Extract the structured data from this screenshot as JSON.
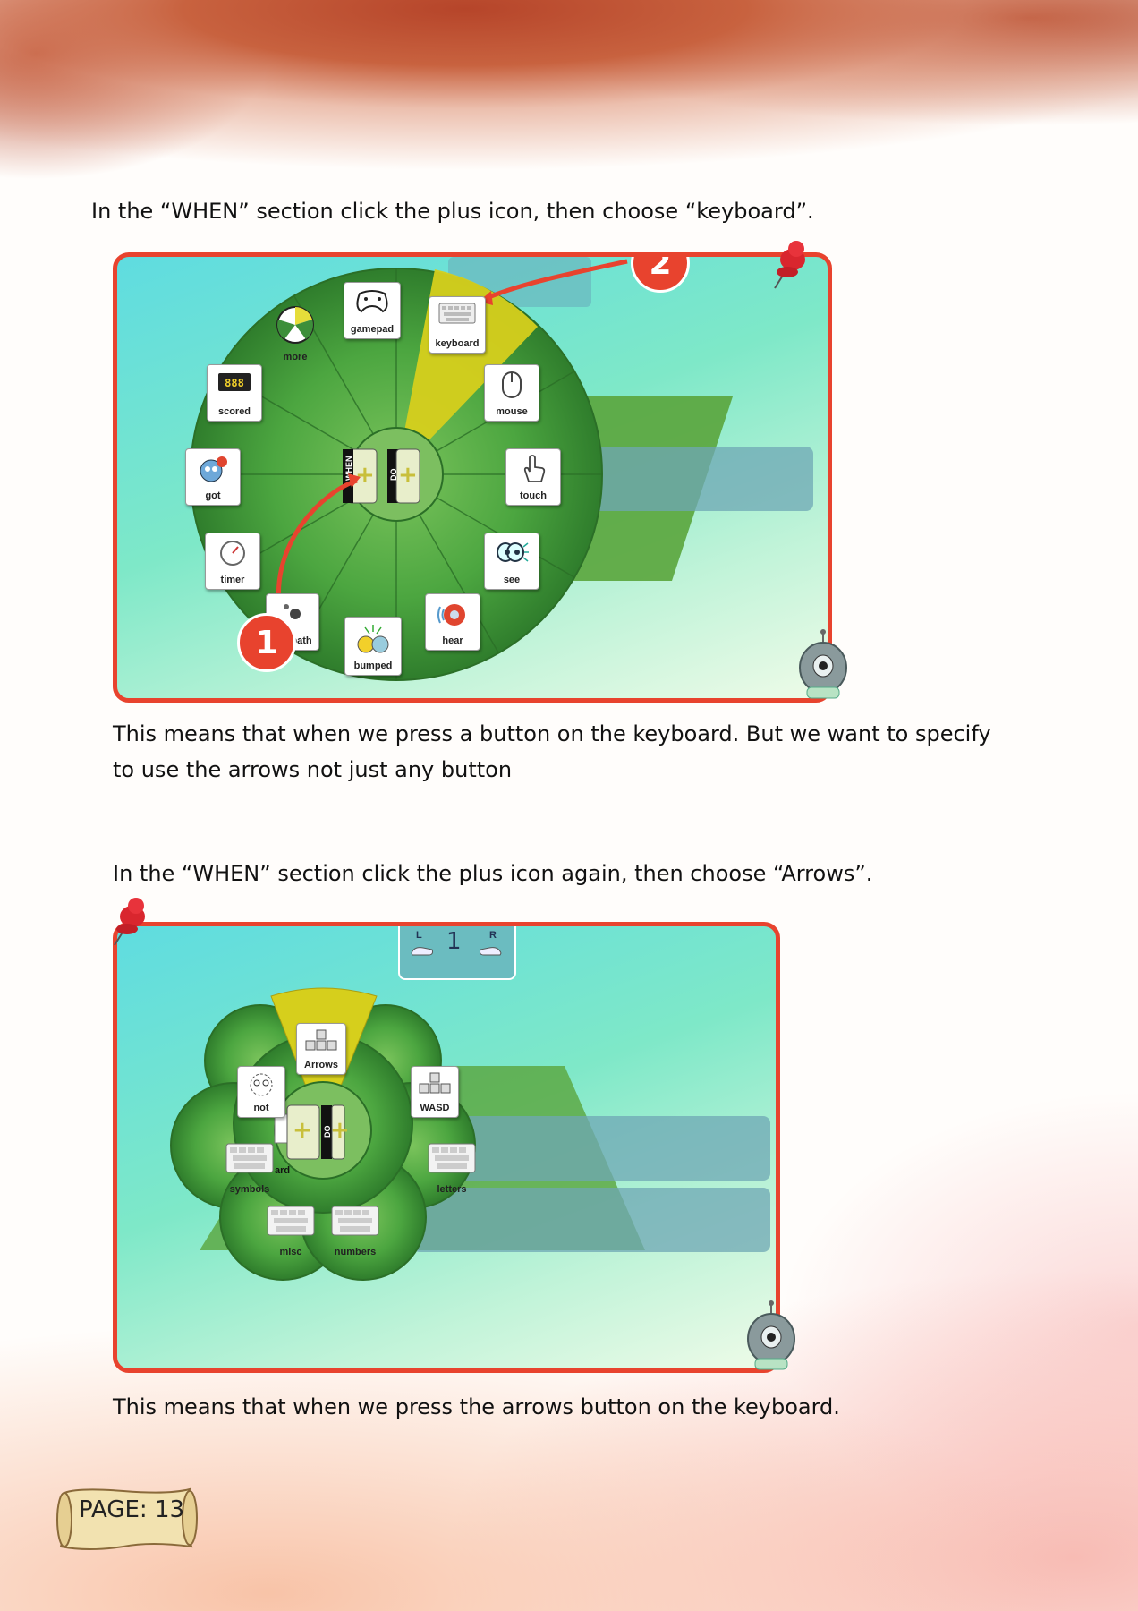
{
  "step1": {
    "instruction": "In the “WHEN” section click the plus icon, then choose “keyboard”.",
    "explanation_line1": "This means that when we press a button on the keyboard. But we want to specify",
    "explanation_line2": "to use the arrows not just any button",
    "badges": [
      "1",
      "2"
    ],
    "wheel_tiles": [
      {
        "label": "gamepad",
        "icon": "gamepad-icon"
      },
      {
        "label": "keyboard",
        "icon": "keyboard-icon",
        "highlighted": true
      },
      {
        "label": "more",
        "icon": "pie-icon"
      },
      {
        "label": "scored",
        "icon": "scoreboard-icon"
      },
      {
        "label": "mouse",
        "icon": "mouse-icon"
      },
      {
        "label": "got",
        "icon": "apple-face-icon"
      },
      {
        "label": "touch",
        "icon": "hand-icon"
      },
      {
        "label": "timer",
        "icon": "timer-icon"
      },
      {
        "label": "see",
        "icon": "eyes-icon"
      },
      {
        "label": "path",
        "icon": "path-icon"
      },
      {
        "label": "hear",
        "icon": "speaker-icon"
      },
      {
        "label": "bumped",
        "icon": "bumped-icon"
      }
    ],
    "center": {
      "when": "WHEN",
      "do": "DO"
    }
  },
  "step2": {
    "instruction": "In the “WHEN” section click the plus icon again, then choose “Arrows”.",
    "explanation": "This means that when we press the arrows button on the keyboard.",
    "wheel_tiles": [
      {
        "label": "Arrows",
        "icon": "arrow-keys-icon",
        "highlighted": true
      },
      {
        "label": "not",
        "icon": "not-face-icon"
      },
      {
        "label": "WASD",
        "icon": "wasd-icon"
      },
      {
        "label": "symbols",
        "icon": "keyboard-icon"
      },
      {
        "label": "letters",
        "icon": "keyboard-icon"
      },
      {
        "label": "misc",
        "icon": "keyboard-icon"
      },
      {
        "label": "numbers",
        "icon": "keyboard-icon"
      }
    ],
    "center": {
      "partial": "ard",
      "do": "DO"
    },
    "top_panel": {
      "left": "L",
      "right": "R",
      "number": "1"
    }
  },
  "page": {
    "label": "PAGE: 13"
  },
  "colors": {
    "frame": "#e8432e",
    "wheel": "#3f9a3a",
    "highlight": "#d8cf1a",
    "badge": "#e8432e"
  }
}
